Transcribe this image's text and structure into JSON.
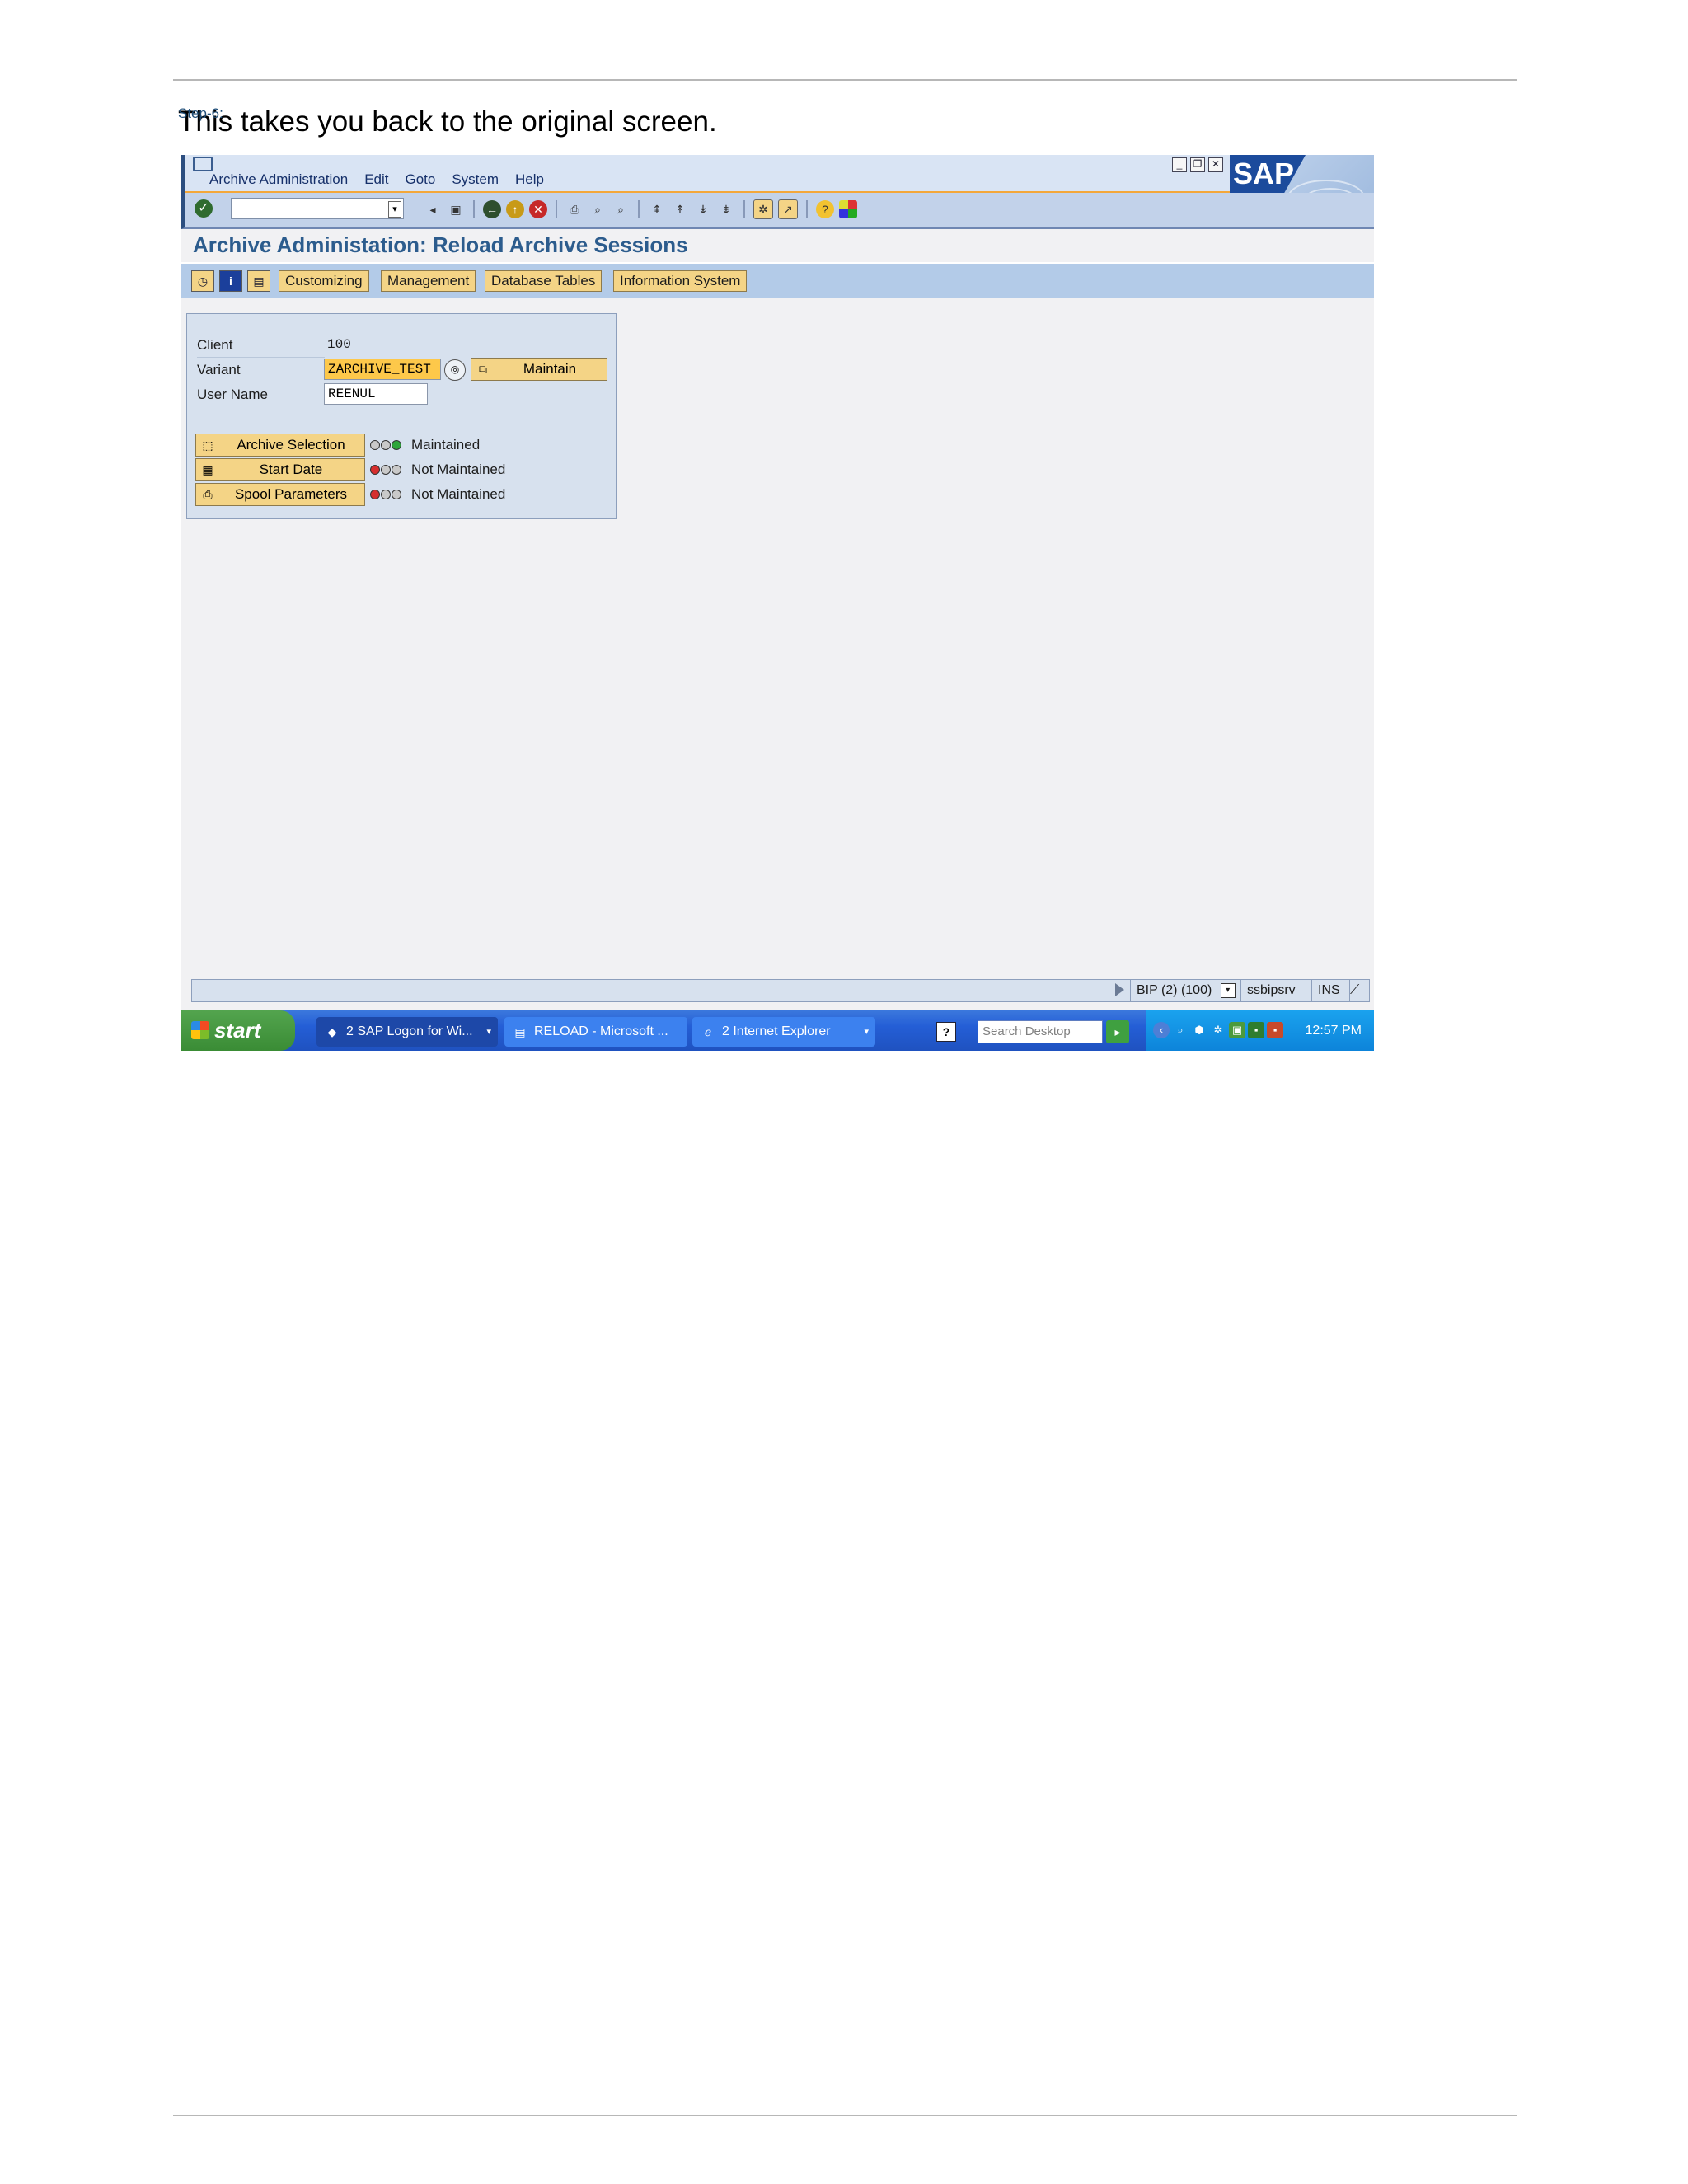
{
  "step": {
    "label": "Step-6:",
    "text": "This takes you back to the original screen."
  },
  "sap": {
    "menu": [
      "Archive Administration",
      "Edit",
      "Goto",
      "System",
      "Help"
    ],
    "logo_text": "SAP",
    "title": "Archive Administation: Reload Archive Sessions",
    "app_buttons": [
      "Customizing",
      "Management",
      "Database Tables",
      "Information System"
    ],
    "client_label": "Client",
    "client_value": "100",
    "variant_label": "Variant",
    "variant_value": "ZARCHIVE_TEST",
    "username_label": "User Name",
    "username_value": "REENUL",
    "maintain_label": "Maintain",
    "rows": [
      {
        "button": "Archive Selection",
        "status": "Maintained",
        "light": "green"
      },
      {
        "button": "Start Date",
        "status": "Not Maintained",
        "light": "red"
      },
      {
        "button": "Spool Parameters",
        "status": "Not Maintained",
        "light": "red"
      }
    ],
    "statusbar": {
      "system": "BIP (2) (100)",
      "server": "ssbipsrv",
      "mode": "INS"
    }
  },
  "taskbar": {
    "start": "start",
    "tasks": [
      "2 SAP Logon for Wi...",
      "RELOAD - Microsoft ...",
      "2 Internet Explorer"
    ],
    "search_placeholder": "Search Desktop",
    "clock": "12:57 PM"
  },
  "colors": {
    "step_label": "#1f4e79",
    "sap_title": "#2c5c8d",
    "field_orange": "#fdc84a",
    "button_yellow": "#f4d486"
  }
}
